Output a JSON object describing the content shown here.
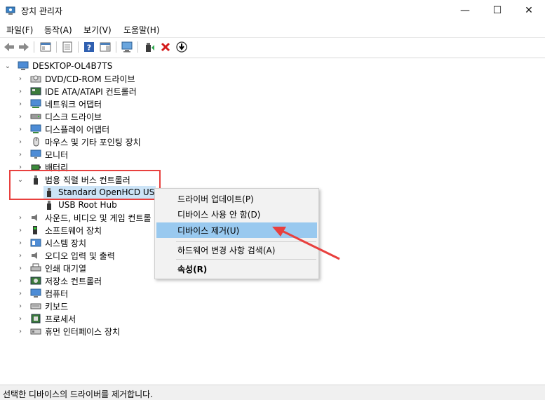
{
  "window": {
    "title": "장치 관리자",
    "minimize_glyph": "—",
    "maximize_glyph": "☐",
    "close_glyph": "✕"
  },
  "menu": [
    "파일(F)",
    "동작(A)",
    "보기(V)",
    "도움말(H)"
  ],
  "tree": {
    "root": "DESKTOP-OL4B7TS",
    "categories": [
      {
        "label": "DVD/CD-ROM 드라이브",
        "icon": "dvd-drive-icon"
      },
      {
        "label": "IDE ATA/ATAPI 컨트롤러",
        "icon": "ide-controller-icon"
      },
      {
        "label": "네트워크 어댑터",
        "icon": "network-adapter-icon"
      },
      {
        "label": "디스크 드라이브",
        "icon": "disk-drive-icon"
      },
      {
        "label": "디스플레이 어댑터",
        "icon": "display-adapter-icon"
      },
      {
        "label": "마우스 및 기타 포인팅 장치",
        "icon": "mouse-icon"
      },
      {
        "label": "모니터",
        "icon": "monitor-icon"
      },
      {
        "label": "배터리",
        "icon": "battery-icon"
      },
      {
        "label": "범용 직렬 버스 컨트롤러",
        "icon": "usb-controller-icon",
        "expanded": true
      },
      {
        "label": "사운드, 비디오 및 게임 컨트롤러",
        "icon": "sound-icon",
        "visible_label": "사운드, 비디오 및 게임 컨트롤"
      },
      {
        "label": "소프트웨어 장치",
        "icon": "software-device-icon"
      },
      {
        "label": "시스템 장치",
        "icon": "system-device-icon"
      },
      {
        "label": "오디오 입력 및 출력",
        "icon": "audio-io-icon"
      },
      {
        "label": "인쇄 대기열",
        "icon": "printer-icon"
      },
      {
        "label": "저장소 컨트롤러",
        "icon": "storage-controller-icon"
      },
      {
        "label": "컴퓨터",
        "icon": "computer-icon"
      },
      {
        "label": "키보드",
        "icon": "keyboard-icon"
      },
      {
        "label": "프로세서",
        "icon": "processor-icon"
      },
      {
        "label": "휴먼 인터페이스 장치",
        "icon": "hid-icon"
      }
    ],
    "usb_children": [
      "Standard OpenHCD USB",
      "USB Root Hub"
    ]
  },
  "context_menu": {
    "update_driver": "드라이버 업데이트(P)",
    "disable_device": "디바이스 사용 안 함(D)",
    "uninstall_device": "디바이스 제거(U)",
    "scan_changes": "하드웨어 변경 사항 검색(A)",
    "properties": "속성(R)"
  },
  "status": "선택한 디바이스의 드라이버를 제거합니다.",
  "colors": {
    "selection": "#99c9ef",
    "highlight_box": "#e8403e",
    "arrow": "#e8403e"
  }
}
